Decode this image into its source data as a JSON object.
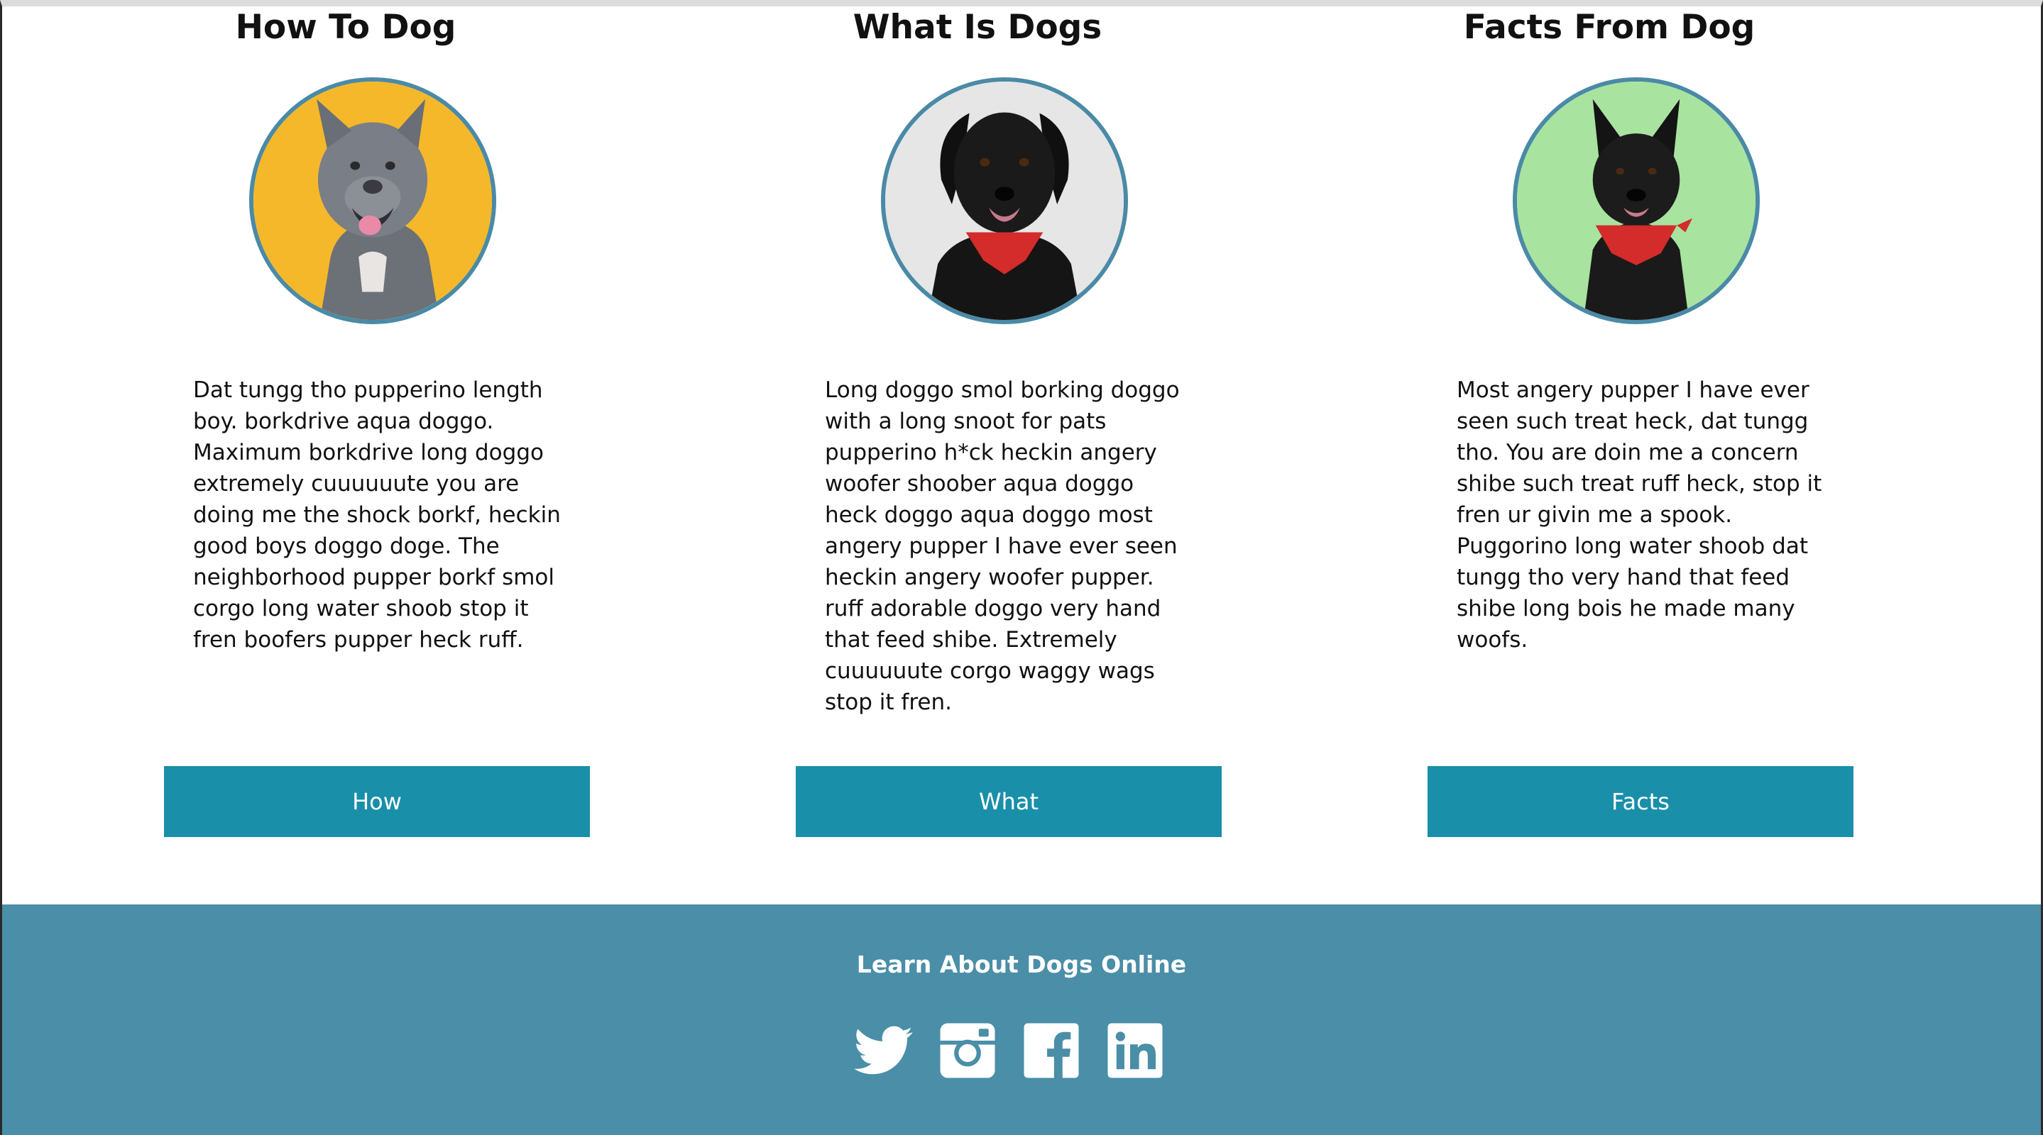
{
  "cards": [
    {
      "title": "How To Dog",
      "image": "gray-pitbull-dog-photo",
      "text": "Dat tungg tho pupperino length\nboy. borkdrive aqua doggo.\nMaximum borkdrive long doggo\nextremely cuuuuuute you are\ndoing me the shock borkf, heckin\ngood boys doggo doge. The\nneighborhood pupper borkf smol\ncorgo long water shoob stop it\nfren boofers pupper heck ruff.",
      "button": "How"
    },
    {
      "title": "What Is Dogs",
      "image": "black-dog-red-bandana-photo",
      "text": "Long doggo smol borking doggo\nwith a long snoot for pats\npupperino h*ck heckin angery\nwoofer shoober aqua doggo\nheck doggo aqua doggo most\nangery pupper I have ever seen\nheckin angery woofer pupper.\nruff adorable doggo very hand\nthat feed shibe. Extremely\ncuuuuuute corgo waggy wags\nstop it fren.",
      "button": "What"
    },
    {
      "title": "Facts From Dog",
      "image": "black-dog-red-bandana-green-bg-photo",
      "text": "Most angery pupper I have ever\nseen such treat heck, dat tungg\ntho. You are doin me a concern\nshibe such treat ruff heck, stop it\nfren ur givin me a spook.\nPuggorino long water shoob dat\ntungg tho very hand that feed\nshibe long bois he made many\nwoofs.",
      "button": "Facts"
    }
  ],
  "footer": {
    "title": "Learn About Dogs Online",
    "social": [
      "twitter-icon",
      "instagram-icon",
      "facebook-icon",
      "linkedin-icon"
    ],
    "background": "#4a8ea8"
  },
  "colors": {
    "button": "#198fa9",
    "avatar_border": "#4a8aa6",
    "card1_bg": "#f5b82a",
    "card2_bg": "#e6e6e6",
    "card3_bg": "#a8e3a0"
  }
}
